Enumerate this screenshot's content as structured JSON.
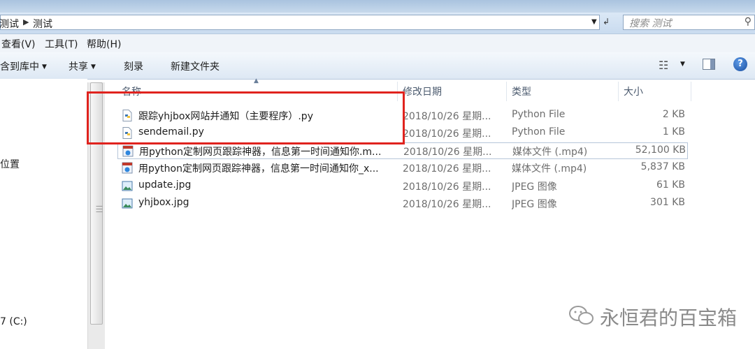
{
  "address": {
    "crumb_parent": "测试",
    "crumb_current": "测试",
    "search_placeholder": "搜索 测试"
  },
  "menu": [
    "查看(V)",
    "工具(T)",
    "帮助(H)"
  ],
  "toolbar": {
    "include_library": "包含到库中",
    "share": "共享",
    "burn": "刻录",
    "new_folder": "新建文件夹"
  },
  "sidebar": {
    "item1": "位置",
    "item2": "7 (C:)"
  },
  "columns": {
    "name": "名称",
    "date": "修改日期",
    "type": "类型",
    "size": "大小"
  },
  "files": [
    {
      "name": "跟踪yhjbox网站并通知（主要程序）.py",
      "date": "2018/10/26 星期...",
      "type": "Python File",
      "size": "2 KB",
      "icon": "python-file-icon"
    },
    {
      "name": "sendemail.py",
      "date": "2018/10/26 星期...",
      "type": "Python File",
      "size": "1 KB",
      "icon": "python-file-icon"
    },
    {
      "name": "用python定制网页跟踪神器，信息第一时间通知你.m...",
      "date": "2018/10/26 星期...",
      "type": "媒体文件 (.mp4)",
      "size": "52,100 KB",
      "icon": "video-file-icon"
    },
    {
      "name": "用python定制网页跟踪神器，信息第一时间通知你_x...",
      "date": "2018/10/26 星期...",
      "type": "媒体文件 (.mp4)",
      "size": "5,837 KB",
      "icon": "video-file-icon"
    },
    {
      "name": "update.jpg",
      "date": "2018/10/26 星期...",
      "type": "JPEG 图像",
      "size": "61 KB",
      "icon": "image-file-icon"
    },
    {
      "name": "yhjbox.jpg",
      "date": "2018/10/26 星期...",
      "type": "JPEG 图像",
      "size": "301 KB",
      "icon": "image-file-icon"
    }
  ],
  "watermark": "永恒君的百宝箱",
  "colors": {
    "highlight": "#e0231e",
    "toolbar_bg": "#dde8f4"
  }
}
